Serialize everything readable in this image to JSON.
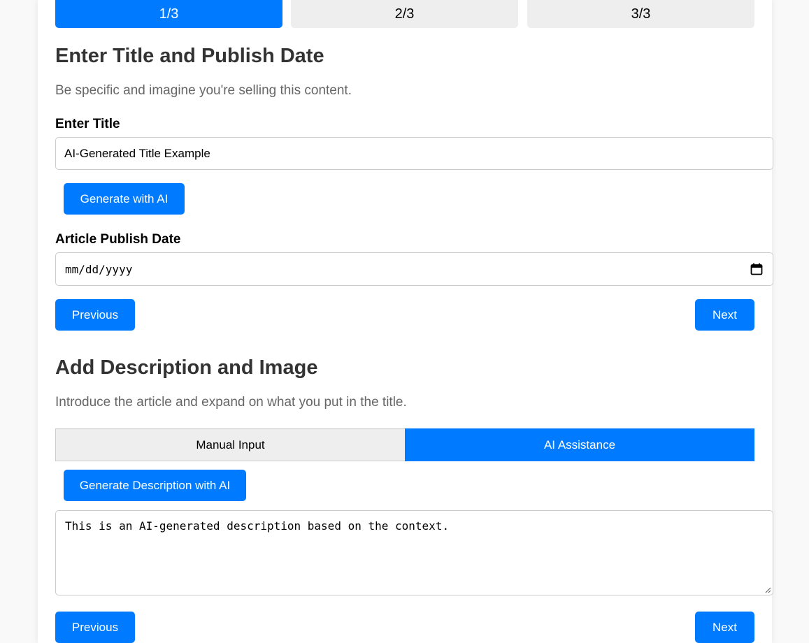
{
  "steps": [
    {
      "label": "1/3",
      "active": true
    },
    {
      "label": "2/3",
      "active": false
    },
    {
      "label": "3/3",
      "active": false
    }
  ],
  "section1": {
    "heading": "Enter Title and Publish Date",
    "subtitle": "Be specific and imagine you're selling this content.",
    "title_label": "Enter Title",
    "title_value": "AI-Generated Title Example",
    "generate_button": "Generate with AI",
    "date_label": "Article Publish Date",
    "date_placeholder": "mm/dd/yyyy",
    "prev_button": "Previous",
    "next_button": "Next"
  },
  "section2": {
    "heading": "Add Description and Image",
    "subtitle": "Introduce the article and expand on what you put in the title.",
    "tabs": [
      {
        "label": "Manual Input",
        "active": false
      },
      {
        "label": "AI Assistance",
        "active": true
      }
    ],
    "generate_button": "Generate Description with AI",
    "description_value": "This is an AI-generated description based on the context.",
    "prev_button": "Previous",
    "next_button": "Next"
  },
  "colors": {
    "accent": "#007bff",
    "inactive_step": "#eeeeee",
    "background": "#f9f9f9"
  }
}
